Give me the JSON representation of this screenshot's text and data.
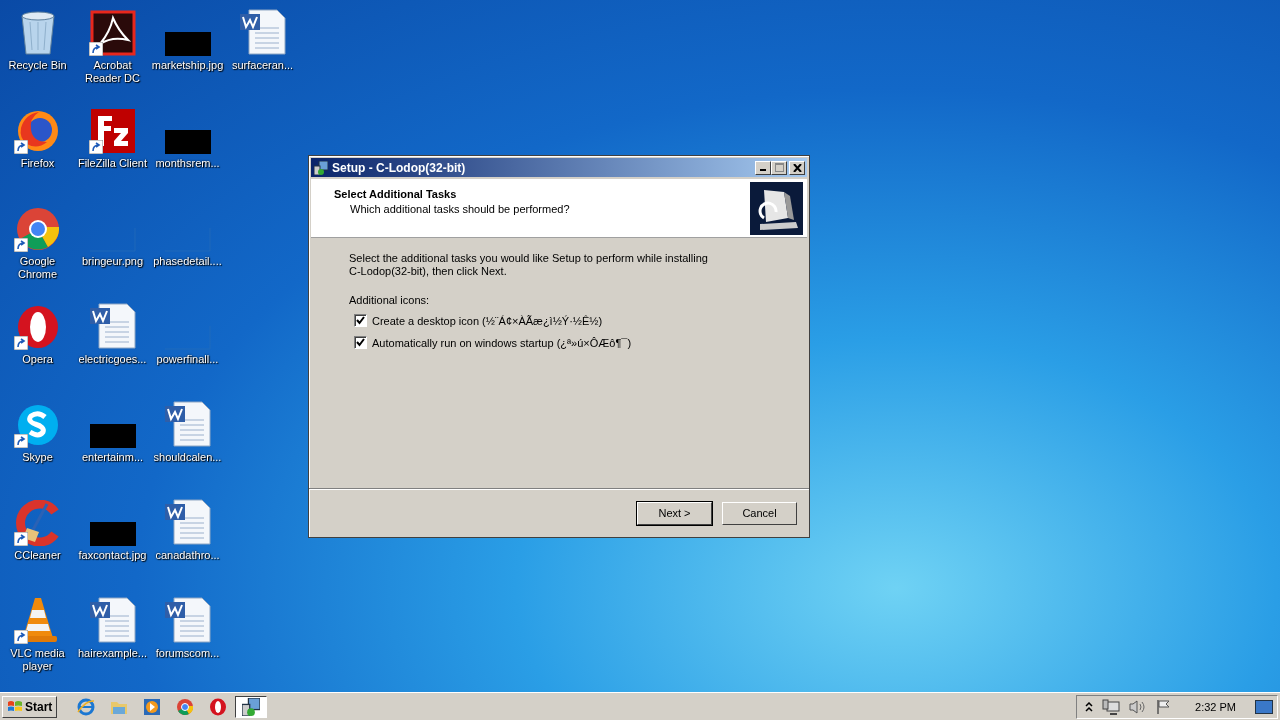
{
  "desktop": {
    "columns": [
      {
        "items": [
          {
            "label": "Recycle Bin",
            "kind": "recycle",
            "shortcut": false
          },
          {
            "label": "Firefox",
            "kind": "firefox",
            "shortcut": true
          },
          {
            "label": "Google Chrome",
            "kind": "chrome",
            "shortcut": true
          },
          {
            "label": "Opera",
            "kind": "opera",
            "shortcut": true
          },
          {
            "label": "Skype",
            "kind": "skype",
            "shortcut": true
          },
          {
            "label": "CCleaner",
            "kind": "ccleaner",
            "shortcut": true
          },
          {
            "label": "VLC media player",
            "kind": "vlc",
            "shortcut": true
          }
        ]
      },
      {
        "items": [
          {
            "label": "Acrobat Reader DC",
            "kind": "acrobat",
            "shortcut": true
          },
          {
            "label": "FileZilla Client",
            "kind": "filezilla",
            "shortcut": true
          },
          {
            "label": "bringeur.png",
            "kind": "image-blank",
            "shortcut": false
          },
          {
            "label": "electricgoes...",
            "kind": "word",
            "shortcut": false
          },
          {
            "label": "entertainm...",
            "kind": "image-black",
            "shortcut": false
          },
          {
            "label": "faxcontact.jpg",
            "kind": "image-black",
            "shortcut": false
          },
          {
            "label": "hairexample...",
            "kind": "word",
            "shortcut": false
          }
        ]
      },
      {
        "items": [
          {
            "label": "marketship.jpg",
            "kind": "image-black",
            "shortcut": false
          },
          {
            "label": "monthsrem...",
            "kind": "image-black",
            "shortcut": false
          },
          {
            "label": "phasedetail....",
            "kind": "image-blank",
            "shortcut": false
          },
          {
            "label": "powerfinall...",
            "kind": "image-blank",
            "shortcut": false
          },
          {
            "label": "shouldcalen...",
            "kind": "word",
            "shortcut": false
          },
          {
            "label": "canadathro...",
            "kind": "word",
            "shortcut": false
          },
          {
            "label": "forumscom...",
            "kind": "word",
            "shortcut": false
          }
        ]
      },
      {
        "items": [
          {
            "label": "surfaceran...",
            "kind": "word",
            "shortcut": false
          }
        ]
      }
    ]
  },
  "window": {
    "title": "Setup - C-Lodop(32-bit)",
    "heading": "Select Additional Tasks",
    "subheading": "Which additional tasks should be performed?",
    "intro": "Select the additional tasks you would like Setup to perform while installing C-Lodop(32-bit), then click Next.",
    "group_label": "Additional icons:",
    "tasks": [
      {
        "label": "Create a desktop icon (½¨Á¢×ÀÃæ¿ì½Ý·½Ê½)",
        "checked": true
      },
      {
        "label": "Automatically run on windows startup (¿ª»ú×ÔÆô¶¯)",
        "checked": true
      }
    ],
    "buttons": [
      {
        "label": "Next >",
        "default": true
      },
      {
        "label": "Cancel",
        "default": false
      }
    ]
  },
  "taskbar": {
    "start": "Start",
    "task": {
      "active": true
    },
    "clock": "2:32 PM"
  }
}
